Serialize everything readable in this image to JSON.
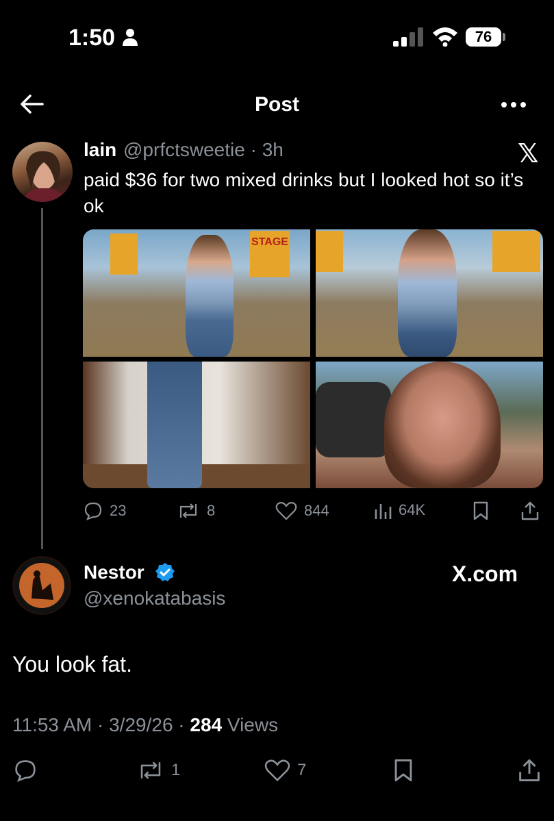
{
  "status_bar": {
    "time": "1:50",
    "battery": "76"
  },
  "header": {
    "title": "Post"
  },
  "quoted_post": {
    "name": "lain",
    "handle": "@prfctsweetie · 3h",
    "text": "paid $36 for two mixed drinks but I looked hot so it’s ok",
    "replies": "23",
    "reposts": "8",
    "likes": "844",
    "views": "64K",
    "image_text": {
      "stage_sign": "STAGE"
    }
  },
  "reply_post": {
    "name": "Nestor",
    "handle": "@xenokatabasis",
    "source": "X.com",
    "text": "You look fat.",
    "time_date": "11:53 AM · 3/29/26 · ",
    "views_count": "284",
    "views_label": " Views",
    "reposts": "1",
    "likes": "7"
  },
  "colors": {
    "background": "#000000",
    "text": "#e7e9ea",
    "secondary": "#8b9198",
    "verified": "#1d9bf0"
  }
}
